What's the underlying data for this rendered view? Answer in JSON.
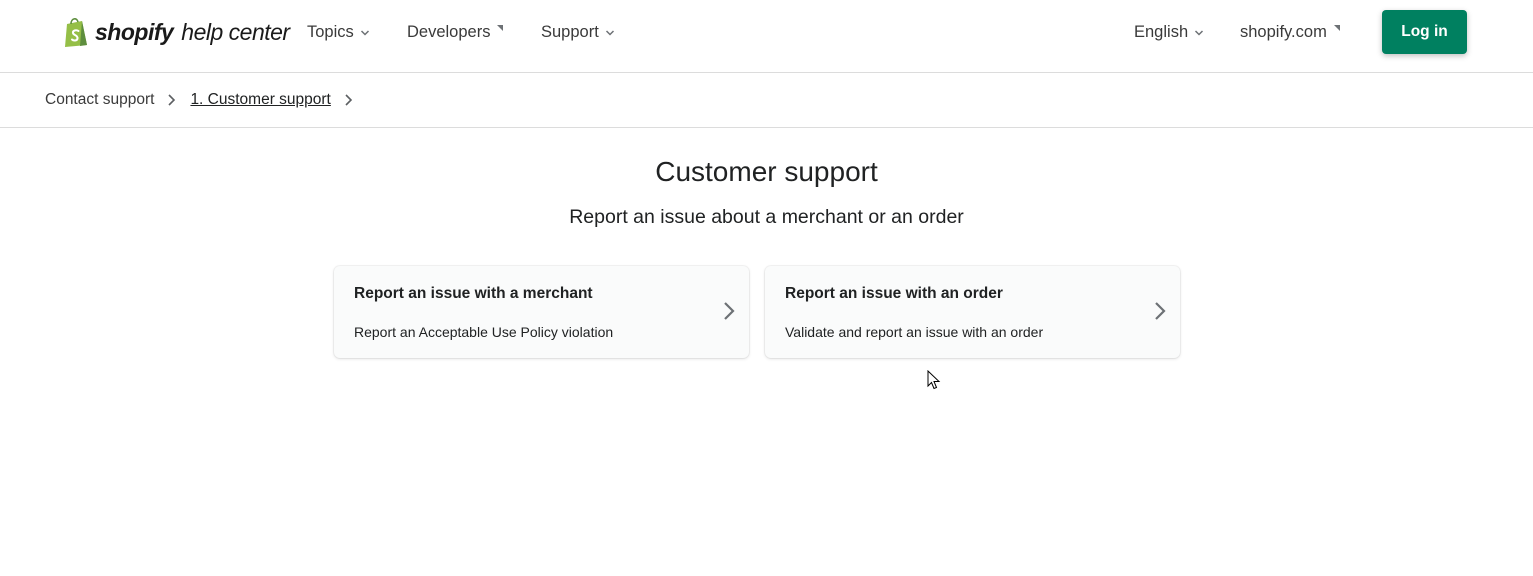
{
  "header": {
    "logo": {
      "brand": "shopify",
      "sub": "help center",
      "icon": "shopify-bag-icon"
    },
    "nav": [
      {
        "label": "Topics",
        "icon": "chevron-down-icon"
      },
      {
        "label": "Developers",
        "icon": "external-link-icon"
      },
      {
        "label": "Support",
        "icon": "chevron-down-icon"
      }
    ],
    "right_nav": [
      {
        "label": "English",
        "icon": "chevron-down-icon"
      },
      {
        "label": "shopify.com",
        "icon": "external-link-icon"
      }
    ],
    "login_label": "Log in"
  },
  "breadcrumb": [
    {
      "label": "Contact support"
    },
    {
      "label": "1. Customer support"
    }
  ],
  "main": {
    "title": "Customer support",
    "subtitle": "Report an issue about a merchant or an order",
    "cards": [
      {
        "title": "Report an issue with a merchant",
        "description": "Report an Acceptable Use Policy violation"
      },
      {
        "title": "Report an issue with an order",
        "description": "Validate and report an issue with an order"
      }
    ]
  },
  "colors": {
    "primary": "#008060",
    "text": "#202223",
    "border": "#dcdcdc",
    "card_bg": "#fafbfb"
  }
}
